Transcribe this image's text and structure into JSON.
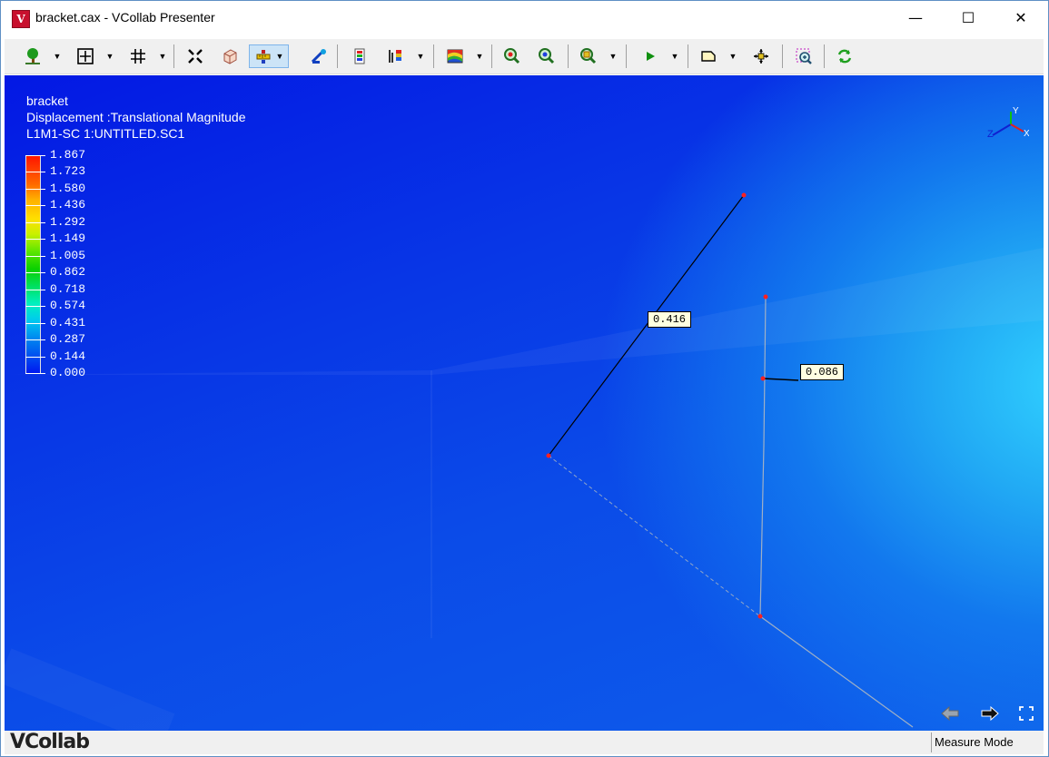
{
  "window": {
    "title": "bracket.cax - VCollab Presenter",
    "app_icon_letter": "V"
  },
  "controls": {
    "minimize": "—",
    "maximize": "☐",
    "close": "✕"
  },
  "toolbar": {
    "buttons": [
      {
        "name": "model-tree-icon"
      },
      {
        "name": "fit-view-icon"
      },
      {
        "name": "grid-icon"
      },
      {
        "name": "explode-icon"
      },
      {
        "name": "cube-view-icon"
      },
      {
        "name": "measure-tool-icon"
      },
      {
        "name": "probe-icon"
      },
      {
        "name": "results-icon"
      },
      {
        "name": "legend-icon"
      },
      {
        "name": "contour-icon"
      },
      {
        "name": "zoom-in-icon"
      },
      {
        "name": "zoom-out-icon"
      },
      {
        "name": "zoom-box-icon"
      },
      {
        "name": "play-animation-icon"
      },
      {
        "name": "annotation-icon"
      },
      {
        "name": "pan-icon"
      },
      {
        "name": "zoom-fit-icon"
      },
      {
        "name": "refresh-icon"
      }
    ]
  },
  "viewport": {
    "model_name": "bracket",
    "result_label": "Displacement :Translational Magnitude",
    "load_case": "L1M1-SC 1:UNTITLED.SC1",
    "legend": {
      "values": [
        "1.867",
        "1.723",
        "1.580",
        "1.436",
        "1.292",
        "1.149",
        "1.005",
        "0.862",
        "0.718",
        "0.574",
        "0.431",
        "0.287",
        "0.144",
        "0.000"
      ]
    },
    "measurements": [
      "0.416",
      "0.086"
    ],
    "triad_labels": {
      "x": "X",
      "y": "Y",
      "z": "Z"
    }
  },
  "statusbar": {
    "logo": "VCollab",
    "mode": "Measure Mode"
  },
  "colors": {
    "viewport_blue": "#0a3ce6",
    "viewport_cyan": "#31d2ff",
    "label_bg": "#ffffe1"
  }
}
